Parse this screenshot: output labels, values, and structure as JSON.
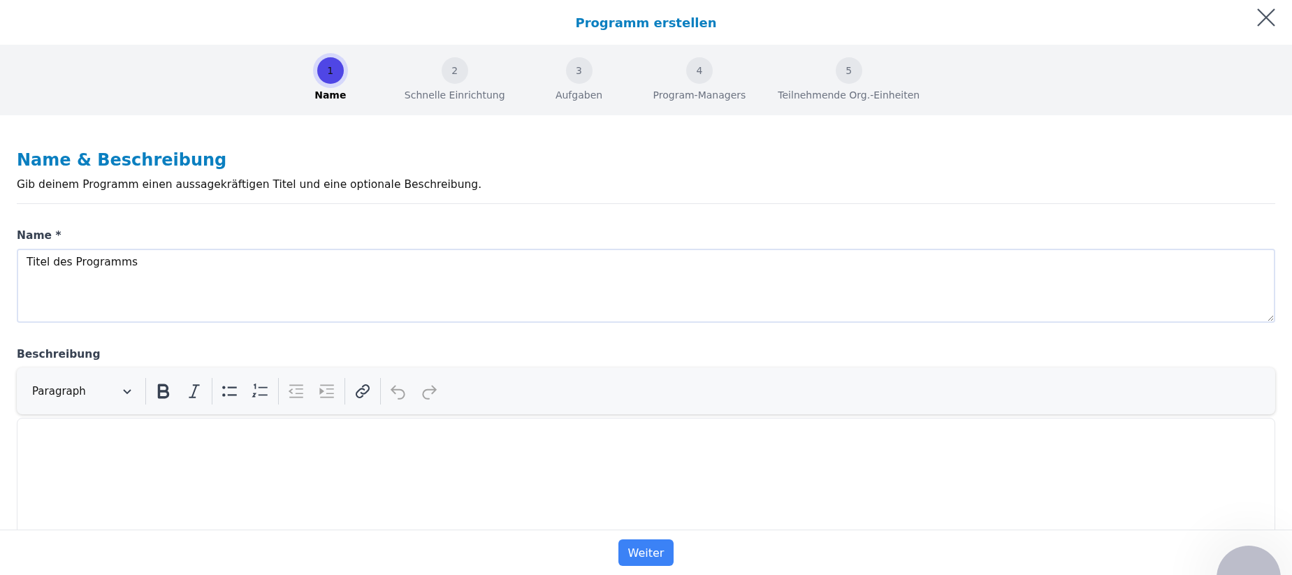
{
  "dialog": {
    "title": "Programm erstellen"
  },
  "steps": [
    {
      "number": "1",
      "label": "Name",
      "selected": true
    },
    {
      "number": "2",
      "label": "Schnelle Einrichtung",
      "selected": false
    },
    {
      "number": "3",
      "label": "Aufgaben",
      "selected": false
    },
    {
      "number": "4",
      "label": "Program-Managers",
      "selected": false
    },
    {
      "number": "5",
      "label": "Teilnehmende Org.-Einheiten",
      "selected": false
    }
  ],
  "section": {
    "heading": "Name & Beschreibung",
    "description": "Gib deinem Programm einen aussagekräftigen Titel und eine optionale Beschreibung."
  },
  "name_field": {
    "label": "Name *",
    "value": "Titel des Programms"
  },
  "description_field": {
    "label": "Beschreibung",
    "block_format": "Paragraph",
    "toolbar": [
      {
        "kind": "bold",
        "disabled": false
      },
      {
        "kind": "italic",
        "disabled": false
      },
      {
        "kind": "sep"
      },
      {
        "kind": "bullets",
        "disabled": false
      },
      {
        "kind": "numbers",
        "disabled": false
      },
      {
        "kind": "sep"
      },
      {
        "kind": "outdent",
        "disabled": true
      },
      {
        "kind": "indent",
        "disabled": true
      },
      {
        "kind": "sep"
      },
      {
        "kind": "link",
        "disabled": false
      },
      {
        "kind": "sep"
      },
      {
        "kind": "undo",
        "disabled": true
      },
      {
        "kind": "redo",
        "disabled": true
      }
    ]
  },
  "footer": {
    "next_button": "Weiter"
  }
}
